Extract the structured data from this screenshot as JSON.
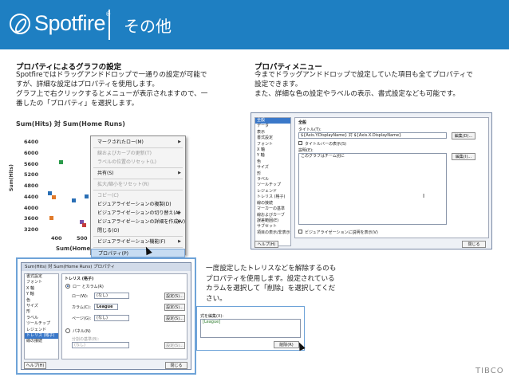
{
  "header": {
    "logo_text": "Spotfire",
    "logo_reg": "®",
    "title": "その他"
  },
  "left_section": {
    "title": "プロパティによるグラフの設定",
    "lines": [
      "Spotfireではドラッグアンドドロップで一通りの設定が可能で",
      "すが、詳細な設定はプロパティを使用します。",
      "グラフ上で右クリックするとメニューが表示されますので、一",
      "番したの「プロパティ」を選択します。"
    ]
  },
  "right_section": {
    "title": "プロパティメニュー",
    "lines": [
      "今までドラッグアンドドロップで設定していた項目も全てプロパティで",
      "設定できます。",
      "また、詳細な色の設定やラベルの表示、書式設定なども可能です。"
    ]
  },
  "chart": {
    "title": "Sum(Hits) 対 Sum(Home Runs)",
    "ylabel": "Sum(Hits)",
    "xlabel": "Sum(Home Runs)",
    "yticks": [
      "6400",
      "6000",
      "5600",
      "5200",
      "4800",
      "4400",
      "4000",
      "3600",
      "3200"
    ],
    "xticks": [
      "400",
      "500",
      "6"
    ]
  },
  "chart_data": {
    "type": "scatter",
    "title": "Sum(Hits) 対 Sum(Home Runs)",
    "xlabel": "Sum(Home Runs)",
    "ylabel": "Sum(Hits)",
    "ylim": [
      3200,
      6400
    ],
    "xlim": [
      350,
      650
    ],
    "yticks": [
      6400,
      6000,
      5600,
      5200,
      4800,
      4400,
      4000,
      3600,
      3200
    ],
    "xticks": [
      400,
      500,
      600
    ],
    "points": [
      {
        "x": 375,
        "y": 4550,
        "color": "#2a6fb5"
      },
      {
        "x": 390,
        "y": 4380,
        "color": "#e07a2a"
      },
      {
        "x": 420,
        "y": 5680,
        "color": "#2a9a4a"
      },
      {
        "x": 500,
        "y": 3500,
        "color": "#7b52a8"
      },
      {
        "x": 510,
        "y": 3380,
        "color": "#c43b3b"
      },
      {
        "x": 520,
        "y": 4420,
        "color": "#2a6fb5"
      },
      {
        "x": 545,
        "y": 3900,
        "color": "#e0b42a"
      },
      {
        "x": 555,
        "y": 4060,
        "color": "#2a9a4a"
      },
      {
        "x": 380,
        "y": 3650,
        "color": "#e07a2a"
      },
      {
        "x": 470,
        "y": 4280,
        "color": "#2a6fb5"
      }
    ]
  },
  "context_menu": {
    "items": [
      {
        "label": "マークされたロー(M)",
        "arrow": true,
        "disabled": false
      },
      {
        "label": "線およびカーブの更新(T)",
        "arrow": false,
        "disabled": true
      },
      {
        "label": "ラベルの位置のリセット(L)",
        "arrow": false,
        "disabled": true
      },
      {
        "label": "共有(S)",
        "arrow": true,
        "disabled": false
      },
      {
        "label": "拡大/縮小をリセット(R)",
        "arrow": false,
        "disabled": true
      },
      {
        "label": "コピー(C)",
        "arrow": false,
        "disabled": true
      },
      {
        "label": "ビジュアライゼーションの複製(D)",
        "arrow": false,
        "disabled": false
      },
      {
        "label": "ビジュアライゼーションの切り替え(A)",
        "arrow": true,
        "disabled": false
      },
      {
        "label": "ビジュアライゼーションの詳細を作成(V)",
        "arrow": true,
        "disabled": false
      },
      {
        "label": "閉じる(O)",
        "arrow": false,
        "disabled": false
      },
      {
        "label": "ビジュアライゼーション機能(F)",
        "arrow": true,
        "disabled": false
      },
      {
        "label": "プロパティ(P)",
        "arrow": false,
        "disabled": false,
        "selected": true
      }
    ]
  },
  "prop_dialog": {
    "tree": [
      "全般",
      "データ",
      "表示",
      "書式設定",
      "フォント",
      "X 軸",
      "Y 軸",
      "色",
      "サイズ",
      "形",
      "ラベル",
      "ツールチップ",
      "レジェンド",
      "トレリス (格子)",
      "線の接続",
      "マーカーの基準",
      "線およびカーブ",
      "誤差範囲(E)",
      "サブセット",
      "項目の表示/非表示"
    ],
    "header": "全般",
    "title_label": "タイトル(T):",
    "title_value": "${Axis.Y.DisplayName} 対 ${Axis.X.DisplayName}",
    "edit1": "編集(D)...",
    "show_title": "タイトルバーの表示(S)",
    "desc_label": "説明(E):",
    "desc_value": "このグラフはチーム別に",
    "edit2": "編集(I)...",
    "show_desc": "ビジュアライゼーションに説明を表示(V)",
    "help": "ヘルプ(H)",
    "close": "閉じる"
  },
  "bottom_right_text": [
    "一度設定したトレリスなどを解除するのも",
    "プロパティを使用します。設定されている",
    "カラムを選択して「削除」を選択してくだ",
    "さい。"
  ],
  "trellis_dialog": {
    "title": "Sum(Hits) 対 Sum(Home Runs) プロパティ",
    "tree": [
      "書式設定",
      "フォント",
      "X 軸",
      "Y 軸",
      "色",
      "サイズ",
      "形",
      "ラベル",
      "ツールチップ",
      "レジェンド",
      "トレリス (格子)",
      "線の接続"
    ],
    "section": "トレリス (格子)",
    "radio1": "ロー とカラム(R)",
    "row_label": "ロー(W):",
    "row_value": "(なし)",
    "col_label": "カラム(C):",
    "col_value": "League",
    "page_label": "ページ(G):",
    "page_value": "(なし)",
    "radio2": "パネル(N)",
    "split_label": "分割の基準(B):",
    "split_value": "(なし)",
    "settings": "設定(S)...",
    "help": "ヘルプ(H)",
    "close": "閉じる"
  },
  "mini_dialog": {
    "top": "式を編集(X):",
    "value": "[League]",
    "delete": "削除(R)"
  },
  "footer": {
    "brand": "TIBCO"
  }
}
